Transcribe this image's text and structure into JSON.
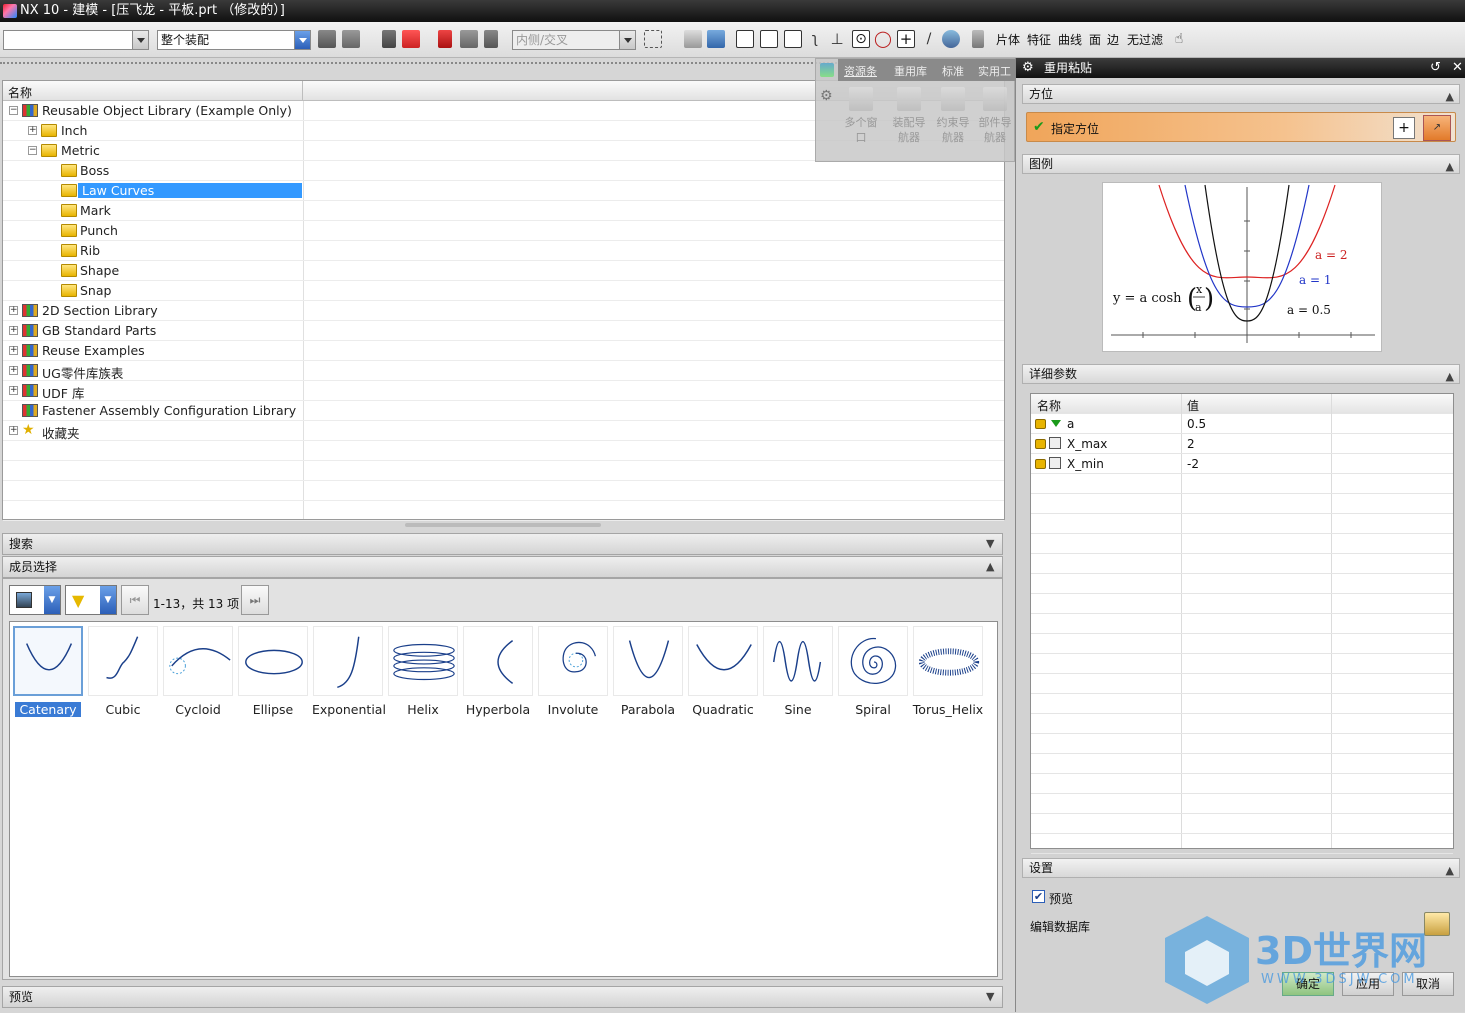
{
  "window": {
    "title": "NX 10 - 建模 - [压飞龙 - 平板.prt （修改的）]"
  },
  "toolbar": {
    "combo1": "",
    "combo2": "整个装配",
    "combo3": "内侧/交叉",
    "filters": [
      "片体",
      "特征",
      "曲线",
      "面",
      "边",
      "无过滤"
    ]
  },
  "floating_toolbox": {
    "tabs": [
      "资源条",
      "重用库",
      "标准",
      "实用工"
    ],
    "tools": [
      "多个窗口",
      "装配导航器",
      "约束导航器",
      "部件导航器"
    ]
  },
  "tree": {
    "header": "名称",
    "rows": [
      {
        "label": "Reusable Object Library (Example Only)",
        "exp": "−"
      },
      {
        "label": "Inch",
        "exp": "+"
      },
      {
        "label": "Metric",
        "exp": "−"
      },
      {
        "label": "Boss",
        "exp": ""
      },
      {
        "label": "Law Curves",
        "exp": ""
      },
      {
        "label": "Mark",
        "exp": ""
      },
      {
        "label": "Punch",
        "exp": ""
      },
      {
        "label": "Rib",
        "exp": ""
      },
      {
        "label": "Shape",
        "exp": ""
      },
      {
        "label": "Snap",
        "exp": ""
      },
      {
        "label": "2D Section Library",
        "exp": "+"
      },
      {
        "label": "GB Standard Parts",
        "exp": "+"
      },
      {
        "label": "Reuse Examples",
        "exp": "+"
      },
      {
        "label": "UG零件库族表",
        "exp": "+"
      },
      {
        "label": "UDF 库",
        "exp": "+"
      },
      {
        "label": "Fastener Assembly Configuration Library",
        "exp": ""
      },
      {
        "label": "收藏夹",
        "exp": "+"
      }
    ]
  },
  "search_panel": {
    "title": "搜索"
  },
  "member_panel": {
    "title": "成员选择",
    "page_info": "1-13，共 13 项",
    "items": [
      "Catenary",
      "Cubic",
      "Cycloid",
      "Ellipse",
      "Exponential",
      "Helix",
      "Hyperbola",
      "Involute",
      "Parabola",
      "Quadratic",
      "Sine",
      "Spiral",
      "Torus_Helix"
    ],
    "selected": "Catenary"
  },
  "preview_panel": {
    "title": "预览"
  },
  "right_panel": {
    "title": "重用粘贴",
    "orientation": {
      "title": "方位",
      "button": "指定方位"
    },
    "legend": {
      "title": "图例",
      "formula": "y = a cosh",
      "frac_num": "x",
      "frac_den": "a",
      "labels": [
        "a = 2",
        "a = 1",
        "a = 0.5"
      ]
    },
    "details": {
      "title": "详细参数",
      "col_name": "名称",
      "col_value": "值",
      "rows": [
        {
          "name": "a",
          "value": "0.5"
        },
        {
          "name": "X_max",
          "value": "2"
        },
        {
          "name": "X_min",
          "value": "-2"
        }
      ]
    },
    "settings": {
      "title": "设置",
      "preview_label": "预览",
      "edit_db_label": "编辑数据库"
    },
    "buttons": [
      "确定",
      "应用",
      "取消"
    ]
  },
  "watermark": {
    "text": "3D世界网",
    "url": "WWW.3DSJW.COM"
  }
}
